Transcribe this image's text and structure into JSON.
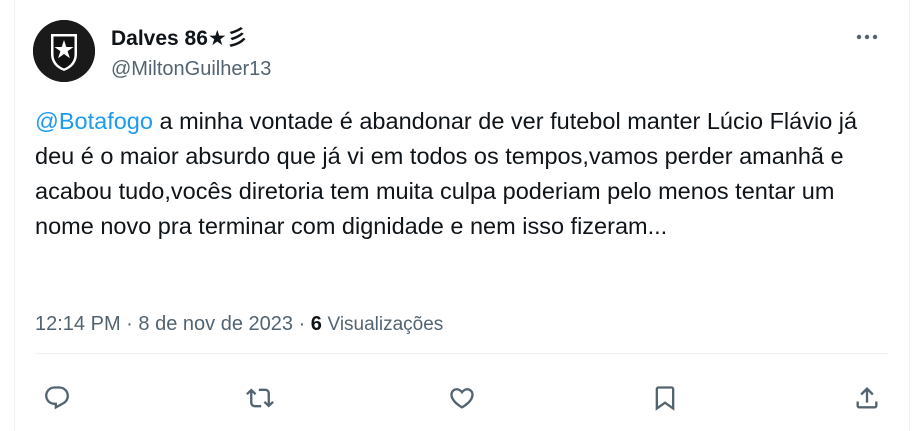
{
  "author": {
    "display_name": "Dalves 86★彡",
    "handle": "@MiltonGuilher13"
  },
  "post": {
    "mention": "@Botafogo",
    "text": " a minha vontade é abandonar de ver futebol manter Lúcio Flávio já deu é o maior absurdo que já vi em todos os tempos,vamos perder amanhã e acabou tudo,vocês diretoria tem muita culpa poderiam pelo menos tentar um nome novo pra terminar com dignidade e nem isso fizeram..."
  },
  "meta": {
    "time": "12:14 PM",
    "separator": "·",
    "date": "8 de nov de 2023",
    "views_count": "6",
    "views_label": "Visualizações"
  },
  "icons": {
    "more": "more-horizontal-icon",
    "reply": "reply-icon",
    "repost": "repost-icon",
    "like": "like-icon",
    "bookmark": "bookmark-icon",
    "share": "share-icon"
  },
  "colors": {
    "link": "#1d9bf0",
    "secondary": "#536471",
    "text": "#0f1419"
  }
}
